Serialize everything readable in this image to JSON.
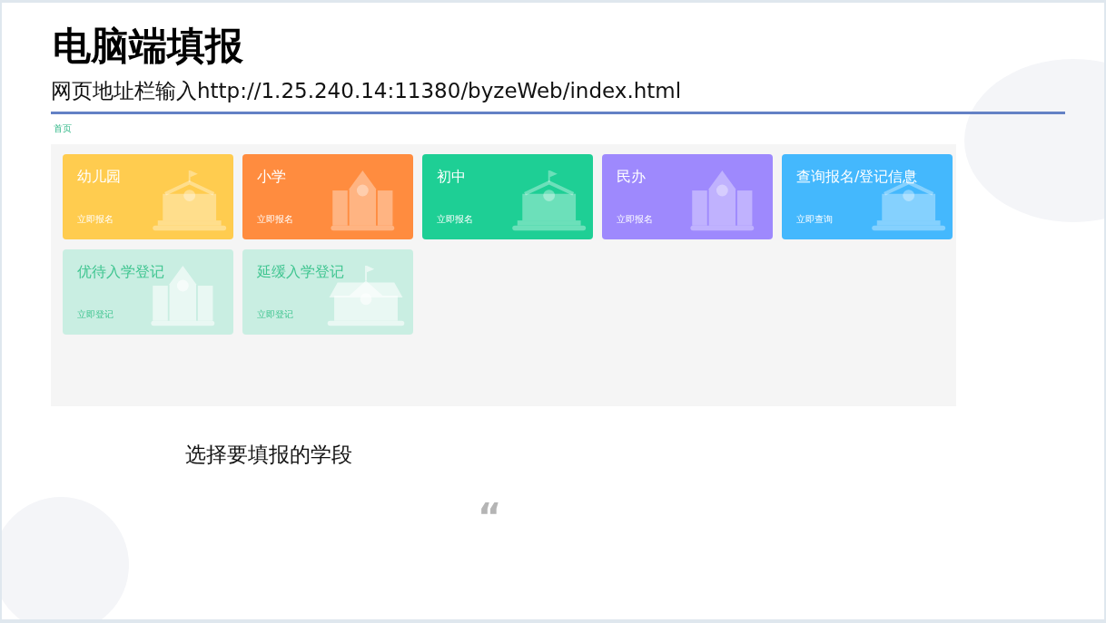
{
  "slide": {
    "title": "电脑端填报",
    "subtitle": "网页地址栏输入http://1.25.240.14:11380/byzeWeb/index.html",
    "caption": "选择要填报的学段",
    "quote_mark": "“"
  },
  "web_page": {
    "breadcrumb": "首页",
    "cards": [
      {
        "title": "幼儿园",
        "action": "立即报名",
        "color": "#ffcc4f",
        "kind": "flag",
        "disabled": false
      },
      {
        "title": "小学",
        "action": "立即报名",
        "color": "#ff8c3f",
        "kind": "tower",
        "disabled": false
      },
      {
        "title": "初中",
        "action": "立即报名",
        "color": "#1ecf95",
        "kind": "flag",
        "disabled": false
      },
      {
        "title": "民办",
        "action": "立即报名",
        "color": "#9e89fd",
        "kind": "tower",
        "disabled": false
      },
      {
        "title": "查询报名/登记信息",
        "action": "立即查询",
        "color": "#44b8fd",
        "kind": "flag",
        "disabled": false
      },
      {
        "title": "优待入学登记",
        "action": "立即登记",
        "color": "#c9eee2",
        "kind": "tower",
        "disabled": true
      },
      {
        "title": "延缓入学登记",
        "action": "立即登记",
        "color": "#c9eee2",
        "kind": "roof",
        "disabled": true
      }
    ]
  }
}
